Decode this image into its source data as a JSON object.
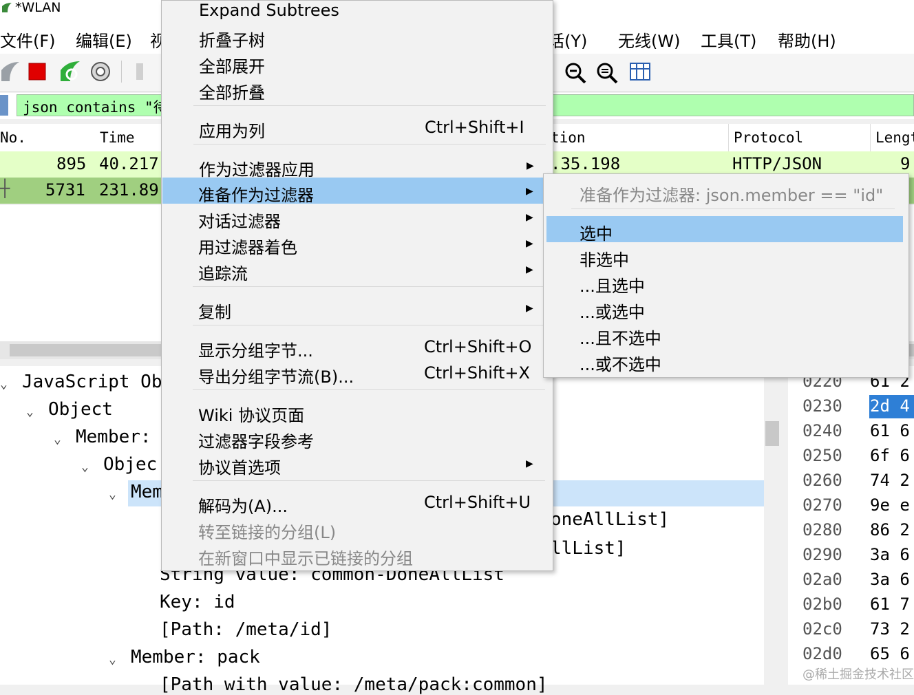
{
  "window": {
    "title": "*WLAN"
  },
  "menubar": {
    "items": [
      "文件(F)",
      "编辑(E)",
      "视",
      "话(Y)",
      "无线(W)",
      "工具(T)",
      "帮助(H)"
    ]
  },
  "filter": {
    "text": "json contains \"待"
  },
  "packet_list": {
    "columns": [
      "No.",
      "Time",
      "tion",
      "Protocol",
      "Lengt"
    ],
    "rows": [
      {
        "no": "895",
        "time": "40.217",
        "dest": ".35.198",
        "protocol": "HTTP/JSON",
        "length": "9"
      },
      {
        "no": "5731",
        "time": "231.89",
        "dest": "",
        "protocol": "",
        "length": ""
      }
    ]
  },
  "detail": {
    "lines": [
      "JavaScript Ob",
      "Object",
      "Member:",
      "Objec",
      "Mem",
      "oneAllList]",
      "llList]",
      "String value: common-DoneAllList",
      "Key: id",
      "[Path: /meta/id]",
      "Member: pack",
      "[Path with value: /meta/pack:common]"
    ]
  },
  "bytes": {
    "offsets": [
      "0220",
      "0230",
      "0240",
      "0250",
      "0260",
      "0270",
      "0280",
      "0290",
      "02a0",
      "02b0",
      "02c0",
      "02d0"
    ],
    "hex": [
      "61 2",
      "2d 4",
      "61 6",
      "6f 6",
      "74 2",
      "9e e",
      "86 2",
      "3a 6",
      "3a 6",
      "61 7",
      "73 2",
      "65 6"
    ]
  },
  "context_menu": {
    "items": {
      "expand_subtrees": "Expand Subtrees",
      "collapse_subtree": "折叠子树",
      "expand_all": "全部展开",
      "collapse_all": "全部折叠",
      "apply_as_column": "应用为列",
      "apply_as_column_sc": "Ctrl+Shift+I",
      "apply_as_filter": "作为过滤器应用",
      "prepare_as_filter": "准备作为过滤器",
      "conversation_filter": "对话过滤器",
      "colorize_with_filter": "用过滤器着色",
      "follow_stream": "追踪流",
      "copy": "复制",
      "show_packet_bytes": "显示分组字节...",
      "show_packet_bytes_sc": "Ctrl+Shift+O",
      "export_packet_bytes": "导出分组字节流(B)...",
      "export_packet_bytes_sc": "Ctrl+Shift+X",
      "wiki_protocol_page": "Wiki 协议页面",
      "filter_field_reference": "过滤器字段参考",
      "protocol_preferences": "协议首选项",
      "decode_as": "解码为(A)...",
      "decode_as_sc": "Ctrl+Shift+U",
      "go_to_linked_packet": "转至链接的分组(L)",
      "show_linked_packet_new_window": "在新窗口中显示已链接的分组"
    }
  },
  "submenu": {
    "header": "准备作为过滤器: json.member == \"id\"",
    "items": [
      "选中",
      "非选中",
      "...且选中",
      "...或选中",
      "...且不选中",
      "...或不选中"
    ]
  },
  "watermark": "@稀土掘金技术社区",
  "colors": {
    "filter_bg": "#afffaf",
    "row_selected": "#a0cf80",
    "highlight": "#99c9f2"
  }
}
